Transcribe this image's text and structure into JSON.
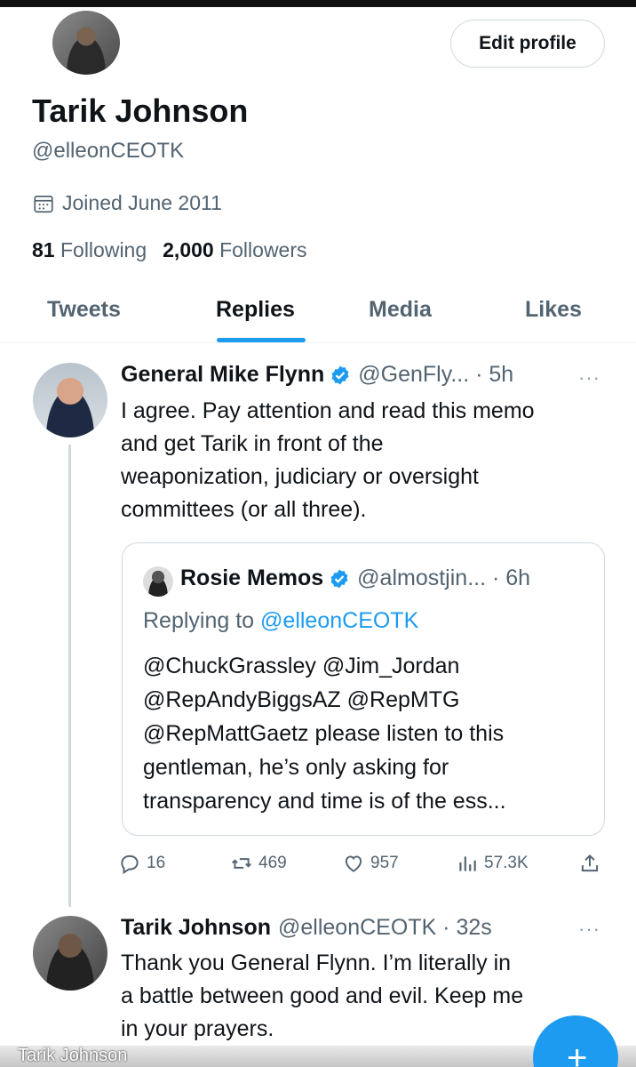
{
  "profile": {
    "name": "Tarik Johnson",
    "handle": "@elleonCEOTK",
    "joined": "Joined June 2011",
    "following_count": "81",
    "following_label": "Following",
    "followers_count": "2,000",
    "followers_label": "Followers",
    "edit_label": "Edit profile"
  },
  "tabs": [
    {
      "label": "Tweets"
    },
    {
      "label": "Replies",
      "active": true
    },
    {
      "label": "Media"
    },
    {
      "label": "Likes"
    }
  ],
  "tweet1": {
    "name": "General Mike Flynn",
    "meta": "@GenFly... · 5h",
    "text_lines": [
      "I agree. Pay attention and read this memo",
      "and get Tarik in front of the",
      "weaponization, judiciary or oversight",
      "committees (or all three)."
    ],
    "quote": {
      "name": "Rosie Memos",
      "meta": "@almostjin... · 6h",
      "replying_prefix": "Replying to ",
      "replying_handle": "@elleonCEOTK",
      "text_lines": [
        "@ChuckGrassley @Jim_Jordan",
        "@RepAndyBiggsAZ @RepMTG",
        "@RepMattGaetz please listen to this",
        "gentleman, he’s only asking for",
        "transparency and time is of the ess..."
      ]
    },
    "actions": {
      "replies": "16",
      "retweets": "469",
      "likes": "957",
      "views": "57.3K"
    }
  },
  "tweet2": {
    "name": "Tarik Johnson",
    "meta": "@elleonCEOTK · 32s",
    "text_lines": [
      "Thank you General Flynn. I’m literally in",
      "a battle between good and evil. Keep me",
      "in your prayers."
    ]
  },
  "watermark": "Tarik Johnson",
  "more_glyph": "···",
  "fab_glyph": "+",
  "colors": {
    "accent": "#1d9bf0",
    "secondary_text": "#536471",
    "border": "#cfd9de"
  }
}
